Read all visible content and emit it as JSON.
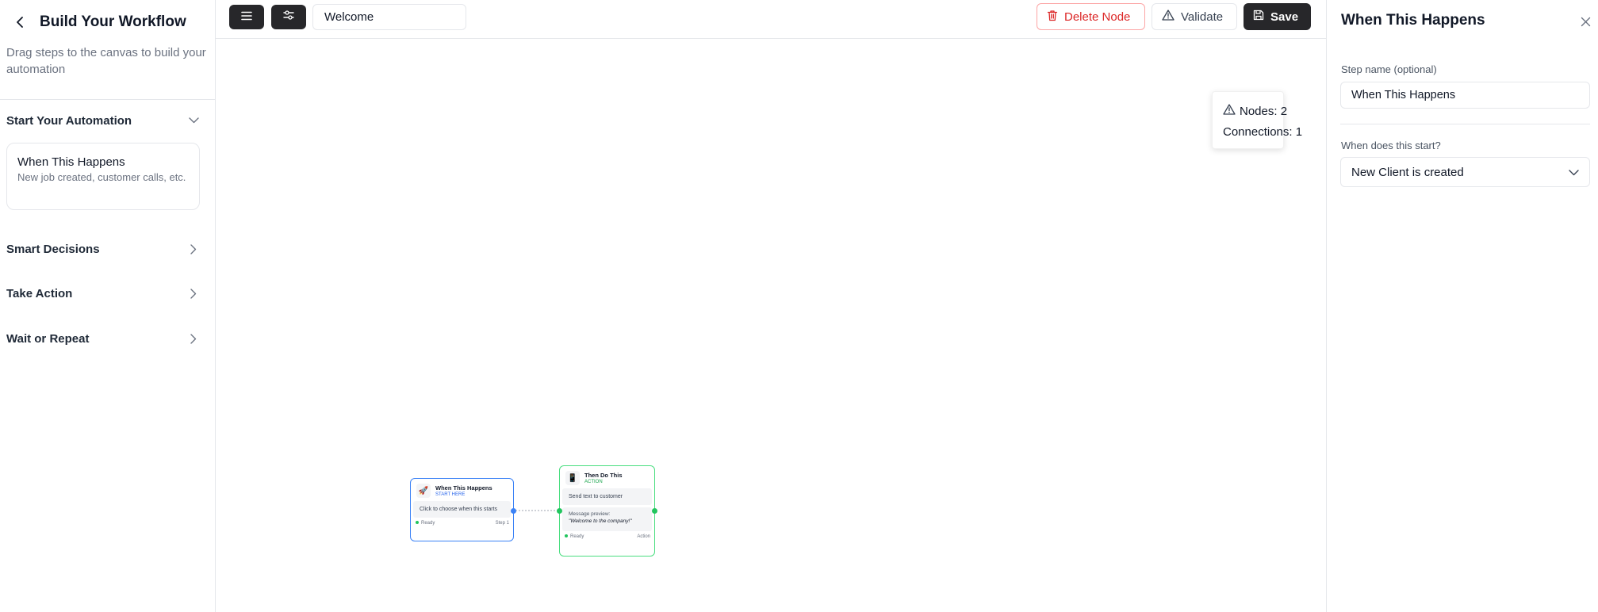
{
  "sidebar": {
    "title": "Build Your Workflow",
    "description": "Drag steps to the canvas to build your automation",
    "sections": [
      {
        "label": "Start Your Automation",
        "expanded": true
      },
      {
        "label": "Smart Decisions",
        "expanded": false
      },
      {
        "label": "Take Action",
        "expanded": false
      },
      {
        "label": "Wait or Repeat",
        "expanded": false
      }
    ],
    "trigger_tile": {
      "title": "When This Happens",
      "description": "New job created, customer calls, etc."
    }
  },
  "toolbar": {
    "workflow_name": "Welcome",
    "delete_label": "Delete Node",
    "validate_label": "Validate",
    "save_label": "Save"
  },
  "stats": {
    "nodes_label": "Nodes: 2",
    "connections_label": "Connections: 1"
  },
  "canvas": {
    "trigger_node": {
      "icon": "rocket-icon",
      "title": "When This Happens",
      "tag": "START HERE",
      "body": "Click to choose when this starts",
      "status": "Ready",
      "step": "Step 1"
    },
    "action_node": {
      "icon": "phone-icon",
      "title": "Then Do This",
      "tag": "ACTION",
      "body": "Send text to customer",
      "preview_label": "Message preview:",
      "preview_text": "\"Welcome to the company!\"",
      "status": "Ready",
      "kind": "Action"
    }
  },
  "panel": {
    "title": "When This Happens",
    "step_name_label": "Step name (optional)",
    "step_name_value": "When This Happens",
    "start_label": "When does this start?",
    "start_value": "New Client is created"
  },
  "colors": {
    "accent_dark": "#27272a",
    "delete_red": "#dc2626",
    "trigger_blue": "#3b82f6",
    "action_green": "#22c55e"
  }
}
